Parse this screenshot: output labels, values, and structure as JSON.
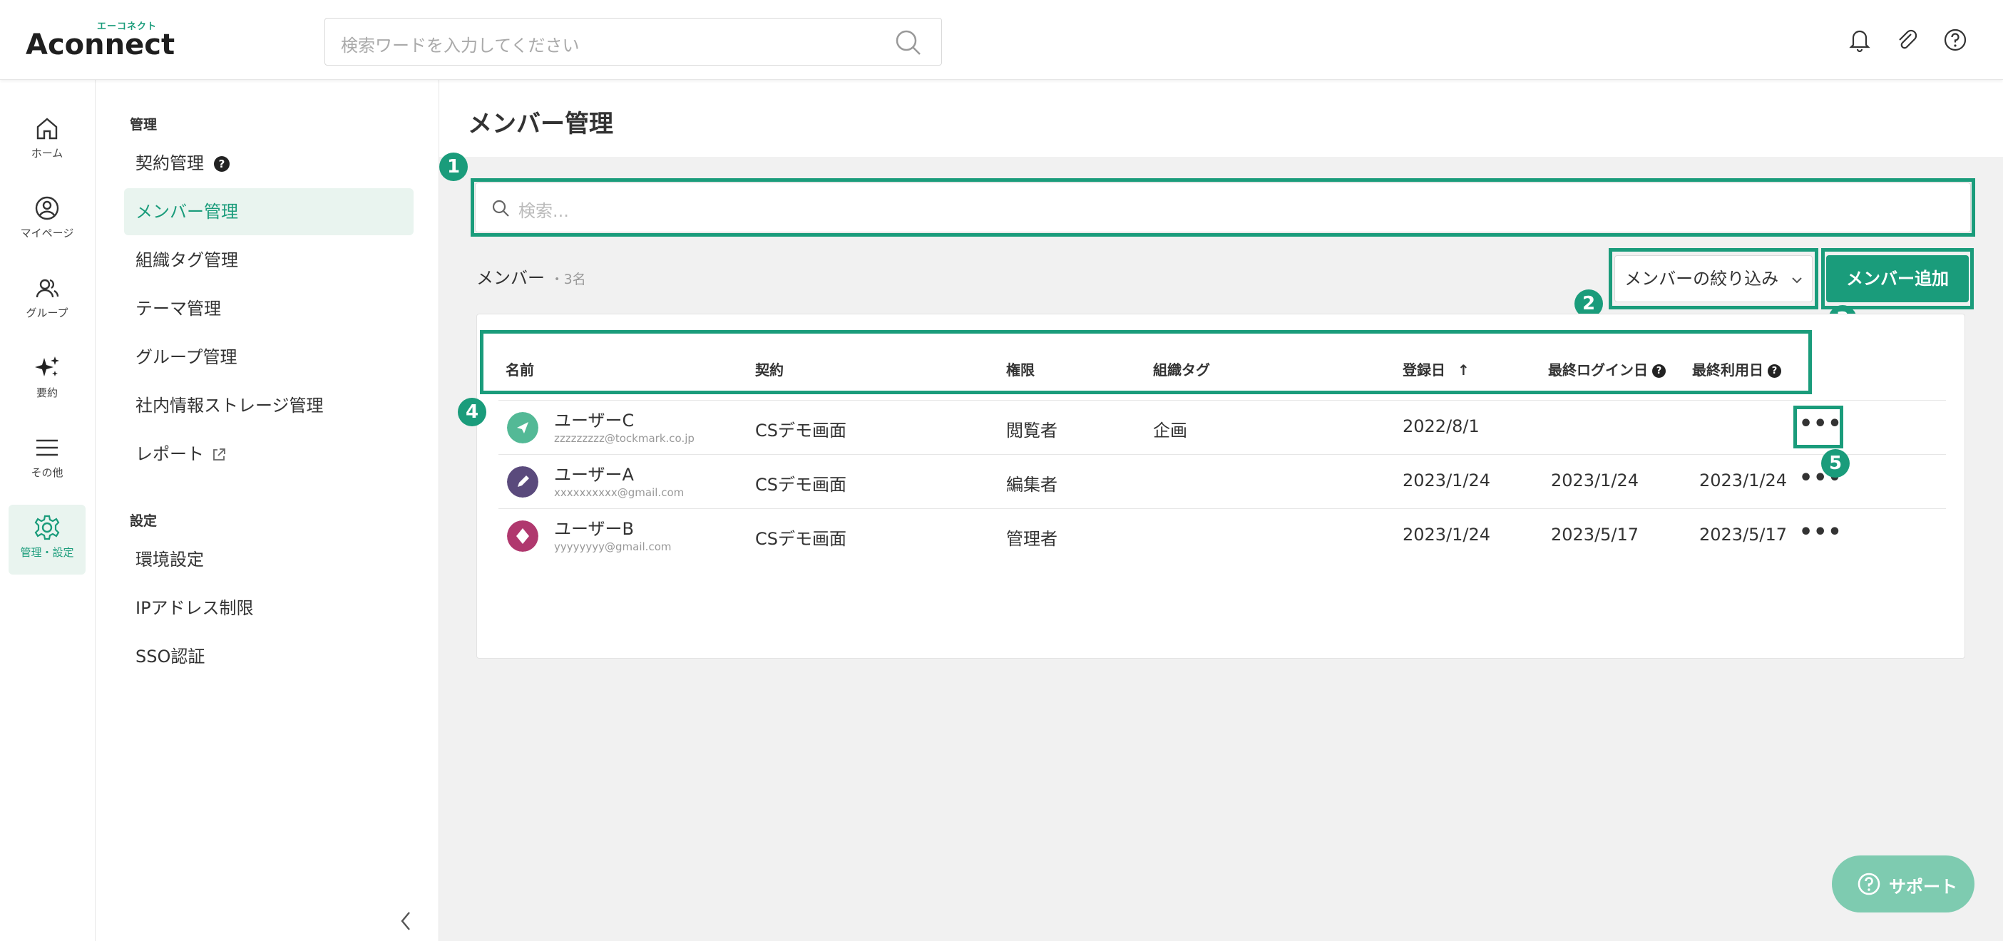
{
  "header": {
    "logo_text": "Aconnect",
    "logo_sub": "エーコネクト",
    "search_placeholder": "検索ワードを入力してください"
  },
  "rail": {
    "items": [
      {
        "label": "ホーム"
      },
      {
        "label": "マイページ"
      },
      {
        "label": "グループ"
      },
      {
        "label": "要約"
      },
      {
        "label": "その他"
      },
      {
        "label": "管理・設定"
      }
    ]
  },
  "subnav": {
    "section1": "管理",
    "items1": [
      "契約管理",
      "メンバー管理",
      "組織タグ管理",
      "テーマ管理",
      "グループ管理",
      "社内情報ストレージ管理",
      "レポート"
    ],
    "section2": "設定",
    "items2": [
      "環境設定",
      "IPアドレス制限",
      "SSO認証"
    ],
    "help_mark": "?"
  },
  "main": {
    "title": "メンバー管理",
    "filter_placeholder": "検索...",
    "members_label": "メンバー",
    "members_count": "・3名",
    "filter_button": "メンバーの絞り込み",
    "add_button": "メンバー追加",
    "badges": [
      "1",
      "2",
      "3",
      "4",
      "5"
    ],
    "columns": [
      "名前",
      "契約",
      "権限",
      "組織タグ",
      "登録日",
      "最終ログイン日",
      "最終利用日"
    ],
    "sort_arrow": "↑",
    "rows": [
      {
        "name": "ユーザーC",
        "email": "zzzzzzzzz@tockmark.co.jp",
        "contract": "CSデモ画面",
        "role": "閲覧者",
        "tag": "企画",
        "registered": "2022/8/1",
        "last_login": "",
        "last_used": "",
        "avatar_color": "#2eaa7f"
      },
      {
        "name": "ユーザーA",
        "email": "xxxxxxxxxx@gmail.com",
        "contract": "CSデモ画面",
        "role": "編集者",
        "tag": "",
        "registered": "2023/1/24",
        "last_login": "2023/1/24",
        "last_used": "2023/1/24",
        "avatar_color": "#5a4a7c"
      },
      {
        "name": "ユーザーB",
        "email": "yyyyyyyy@gmail.com",
        "contract": "CSデモ画面",
        "role": "管理者",
        "tag": "",
        "registered": "2023/1/24",
        "last_login": "2023/5/17",
        "last_used": "2023/5/17",
        "avatar_color": "#b0386e"
      }
    ],
    "more_label": "•••"
  },
  "support": {
    "label": "サポート"
  },
  "colors": {
    "accent": "#1a9c7b",
    "accent_light": "#e9f4ef",
    "support": "#7ecbb0"
  }
}
